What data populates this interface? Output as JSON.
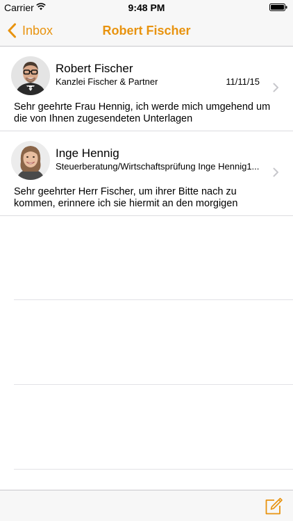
{
  "status_bar": {
    "carrier": "Carrier",
    "time": "9:48 PM",
    "wifi_icon": "wifi-icon",
    "battery_icon": "battery-icon"
  },
  "nav": {
    "back_label": "Inbox",
    "back_icon": "chevron-left-icon",
    "title": "Robert Fischer"
  },
  "messages": [
    {
      "name": "Robert Fischer",
      "company": "Kanzlei Fischer & Partner",
      "date": "11/11/15",
      "preview": "Sehr geehrte Frau Hennig, ich werde mich umgehend um die von Ihnen zugesendeten Unterlagen",
      "avatar_icon": "avatar-robert-fischer"
    },
    {
      "name": "Inge Hennig",
      "company": "Steuerberatung/Wirtschaftsprüfung Inge Hennig1...",
      "date": "",
      "preview": "Sehr geehrter Herr Fischer, um ihrer Bitte nach zu kommen, erinnere ich sie hiermit an den morgigen",
      "avatar_icon": "avatar-inge-hennig"
    }
  ],
  "toolbar": {
    "compose_icon": "compose-icon"
  },
  "colors": {
    "accent": "#e8930f",
    "bar_background": "#f7f7f7",
    "separator": "#dcdcdf",
    "chevron": "#c7c7cc"
  }
}
